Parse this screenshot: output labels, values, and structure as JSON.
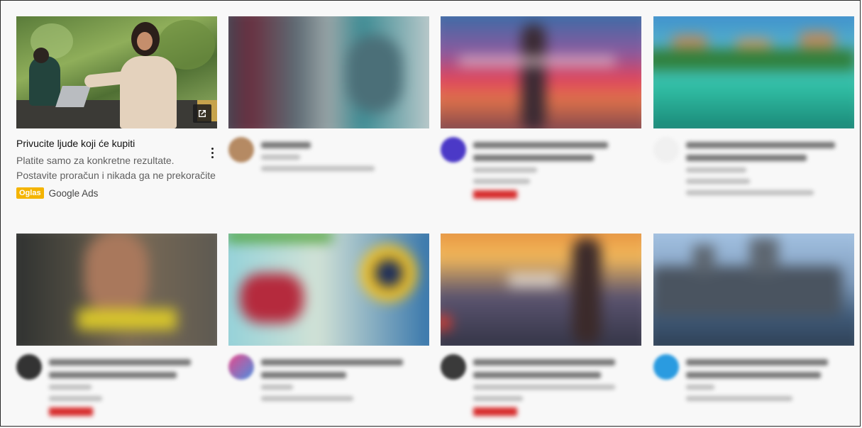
{
  "ad": {
    "title": "Privucite ljude koji će kupiti",
    "description": "Platite samo za konkretne rezultate. Postavite proračun i nikada ga ne prekoračite",
    "badge": "Oglas",
    "advertiser": "Google Ads",
    "badge_color": "#f4b400",
    "menu_icon": "kebab-menu-icon",
    "external_icon": "external-link-icon"
  },
  "blurred_cards": [
    {
      "id": "card-2"
    },
    {
      "id": "card-3",
      "live": true
    },
    {
      "id": "card-4"
    },
    {
      "id": "card-5",
      "live": true
    },
    {
      "id": "card-6"
    },
    {
      "id": "card-7",
      "live": true
    },
    {
      "id": "card-8"
    }
  ],
  "colors": {
    "live_badge": "#d62a2a",
    "background": "#f9f9f9"
  }
}
